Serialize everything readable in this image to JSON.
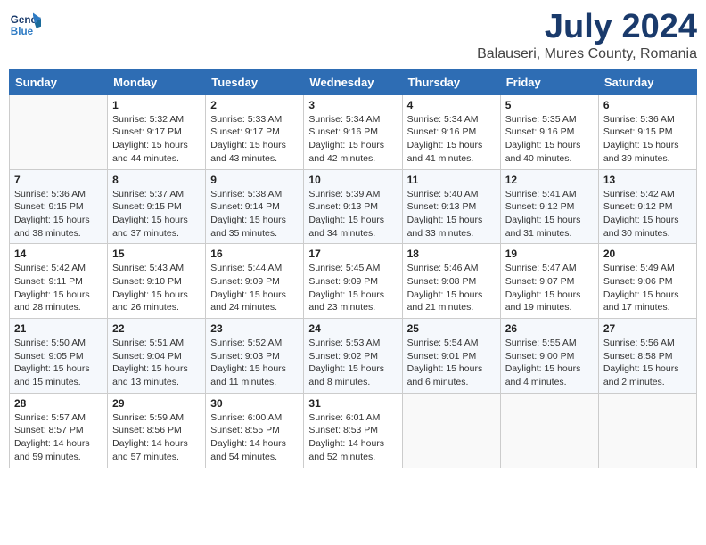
{
  "header": {
    "logo_line1": "General",
    "logo_line2": "Blue",
    "title": "July 2024",
    "subtitle": "Balauseri, Mures County, Romania"
  },
  "days_of_week": [
    "Sunday",
    "Monday",
    "Tuesday",
    "Wednesday",
    "Thursday",
    "Friday",
    "Saturday"
  ],
  "weeks": [
    [
      {
        "day": "",
        "info": ""
      },
      {
        "day": "1",
        "info": "Sunrise: 5:32 AM\nSunset: 9:17 PM\nDaylight: 15 hours\nand 44 minutes."
      },
      {
        "day": "2",
        "info": "Sunrise: 5:33 AM\nSunset: 9:17 PM\nDaylight: 15 hours\nand 43 minutes."
      },
      {
        "day": "3",
        "info": "Sunrise: 5:34 AM\nSunset: 9:16 PM\nDaylight: 15 hours\nand 42 minutes."
      },
      {
        "day": "4",
        "info": "Sunrise: 5:34 AM\nSunset: 9:16 PM\nDaylight: 15 hours\nand 41 minutes."
      },
      {
        "day": "5",
        "info": "Sunrise: 5:35 AM\nSunset: 9:16 PM\nDaylight: 15 hours\nand 40 minutes."
      },
      {
        "day": "6",
        "info": "Sunrise: 5:36 AM\nSunset: 9:15 PM\nDaylight: 15 hours\nand 39 minutes."
      }
    ],
    [
      {
        "day": "7",
        "info": "Sunrise: 5:36 AM\nSunset: 9:15 PM\nDaylight: 15 hours\nand 38 minutes."
      },
      {
        "day": "8",
        "info": "Sunrise: 5:37 AM\nSunset: 9:15 PM\nDaylight: 15 hours\nand 37 minutes."
      },
      {
        "day": "9",
        "info": "Sunrise: 5:38 AM\nSunset: 9:14 PM\nDaylight: 15 hours\nand 35 minutes."
      },
      {
        "day": "10",
        "info": "Sunrise: 5:39 AM\nSunset: 9:13 PM\nDaylight: 15 hours\nand 34 minutes."
      },
      {
        "day": "11",
        "info": "Sunrise: 5:40 AM\nSunset: 9:13 PM\nDaylight: 15 hours\nand 33 minutes."
      },
      {
        "day": "12",
        "info": "Sunrise: 5:41 AM\nSunset: 9:12 PM\nDaylight: 15 hours\nand 31 minutes."
      },
      {
        "day": "13",
        "info": "Sunrise: 5:42 AM\nSunset: 9:12 PM\nDaylight: 15 hours\nand 30 minutes."
      }
    ],
    [
      {
        "day": "14",
        "info": "Sunrise: 5:42 AM\nSunset: 9:11 PM\nDaylight: 15 hours\nand 28 minutes."
      },
      {
        "day": "15",
        "info": "Sunrise: 5:43 AM\nSunset: 9:10 PM\nDaylight: 15 hours\nand 26 minutes."
      },
      {
        "day": "16",
        "info": "Sunrise: 5:44 AM\nSunset: 9:09 PM\nDaylight: 15 hours\nand 24 minutes."
      },
      {
        "day": "17",
        "info": "Sunrise: 5:45 AM\nSunset: 9:09 PM\nDaylight: 15 hours\nand 23 minutes."
      },
      {
        "day": "18",
        "info": "Sunrise: 5:46 AM\nSunset: 9:08 PM\nDaylight: 15 hours\nand 21 minutes."
      },
      {
        "day": "19",
        "info": "Sunrise: 5:47 AM\nSunset: 9:07 PM\nDaylight: 15 hours\nand 19 minutes."
      },
      {
        "day": "20",
        "info": "Sunrise: 5:49 AM\nSunset: 9:06 PM\nDaylight: 15 hours\nand 17 minutes."
      }
    ],
    [
      {
        "day": "21",
        "info": "Sunrise: 5:50 AM\nSunset: 9:05 PM\nDaylight: 15 hours\nand 15 minutes."
      },
      {
        "day": "22",
        "info": "Sunrise: 5:51 AM\nSunset: 9:04 PM\nDaylight: 15 hours\nand 13 minutes."
      },
      {
        "day": "23",
        "info": "Sunrise: 5:52 AM\nSunset: 9:03 PM\nDaylight: 15 hours\nand 11 minutes."
      },
      {
        "day": "24",
        "info": "Sunrise: 5:53 AM\nSunset: 9:02 PM\nDaylight: 15 hours\nand 8 minutes."
      },
      {
        "day": "25",
        "info": "Sunrise: 5:54 AM\nSunset: 9:01 PM\nDaylight: 15 hours\nand 6 minutes."
      },
      {
        "day": "26",
        "info": "Sunrise: 5:55 AM\nSunset: 9:00 PM\nDaylight: 15 hours\nand 4 minutes."
      },
      {
        "day": "27",
        "info": "Sunrise: 5:56 AM\nSunset: 8:58 PM\nDaylight: 15 hours\nand 2 minutes."
      }
    ],
    [
      {
        "day": "28",
        "info": "Sunrise: 5:57 AM\nSunset: 8:57 PM\nDaylight: 14 hours\nand 59 minutes."
      },
      {
        "day": "29",
        "info": "Sunrise: 5:59 AM\nSunset: 8:56 PM\nDaylight: 14 hours\nand 57 minutes."
      },
      {
        "day": "30",
        "info": "Sunrise: 6:00 AM\nSunset: 8:55 PM\nDaylight: 14 hours\nand 54 minutes."
      },
      {
        "day": "31",
        "info": "Sunrise: 6:01 AM\nSunset: 8:53 PM\nDaylight: 14 hours\nand 52 minutes."
      },
      {
        "day": "",
        "info": ""
      },
      {
        "day": "",
        "info": ""
      },
      {
        "day": "",
        "info": ""
      }
    ]
  ]
}
